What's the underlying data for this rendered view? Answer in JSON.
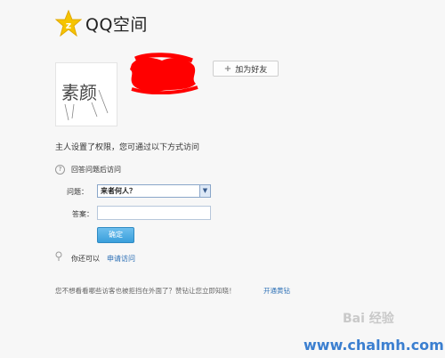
{
  "header": {
    "logo_text": "QQ空间"
  },
  "profile": {
    "add_friend_label": "加为好友",
    "avatar_text": "素颜"
  },
  "access": {
    "notice": "主人设置了权限，您可通过以下方式访问",
    "qa_title": "回答问题后访问",
    "question_label": "问题：",
    "question_value": "来者何人？",
    "answer_label": "答案：",
    "answer_value": "",
    "confirm_label": "确定",
    "alt_prefix": "你还可以",
    "apply_link": "申请访问"
  },
  "footer": {
    "text": "您不想看看哪些访客也被拒挡在外面了？赞钻让您立即知晓！",
    "vip_link": "开通黄钻"
  },
  "watermark": {
    "baidu": "Bai 经验",
    "site": "www.chalmh.com"
  },
  "colors": {
    "link": "#2b6fb5",
    "button": "#3a9fdb",
    "redact": "#ff0000",
    "logo": "#f5c400"
  }
}
